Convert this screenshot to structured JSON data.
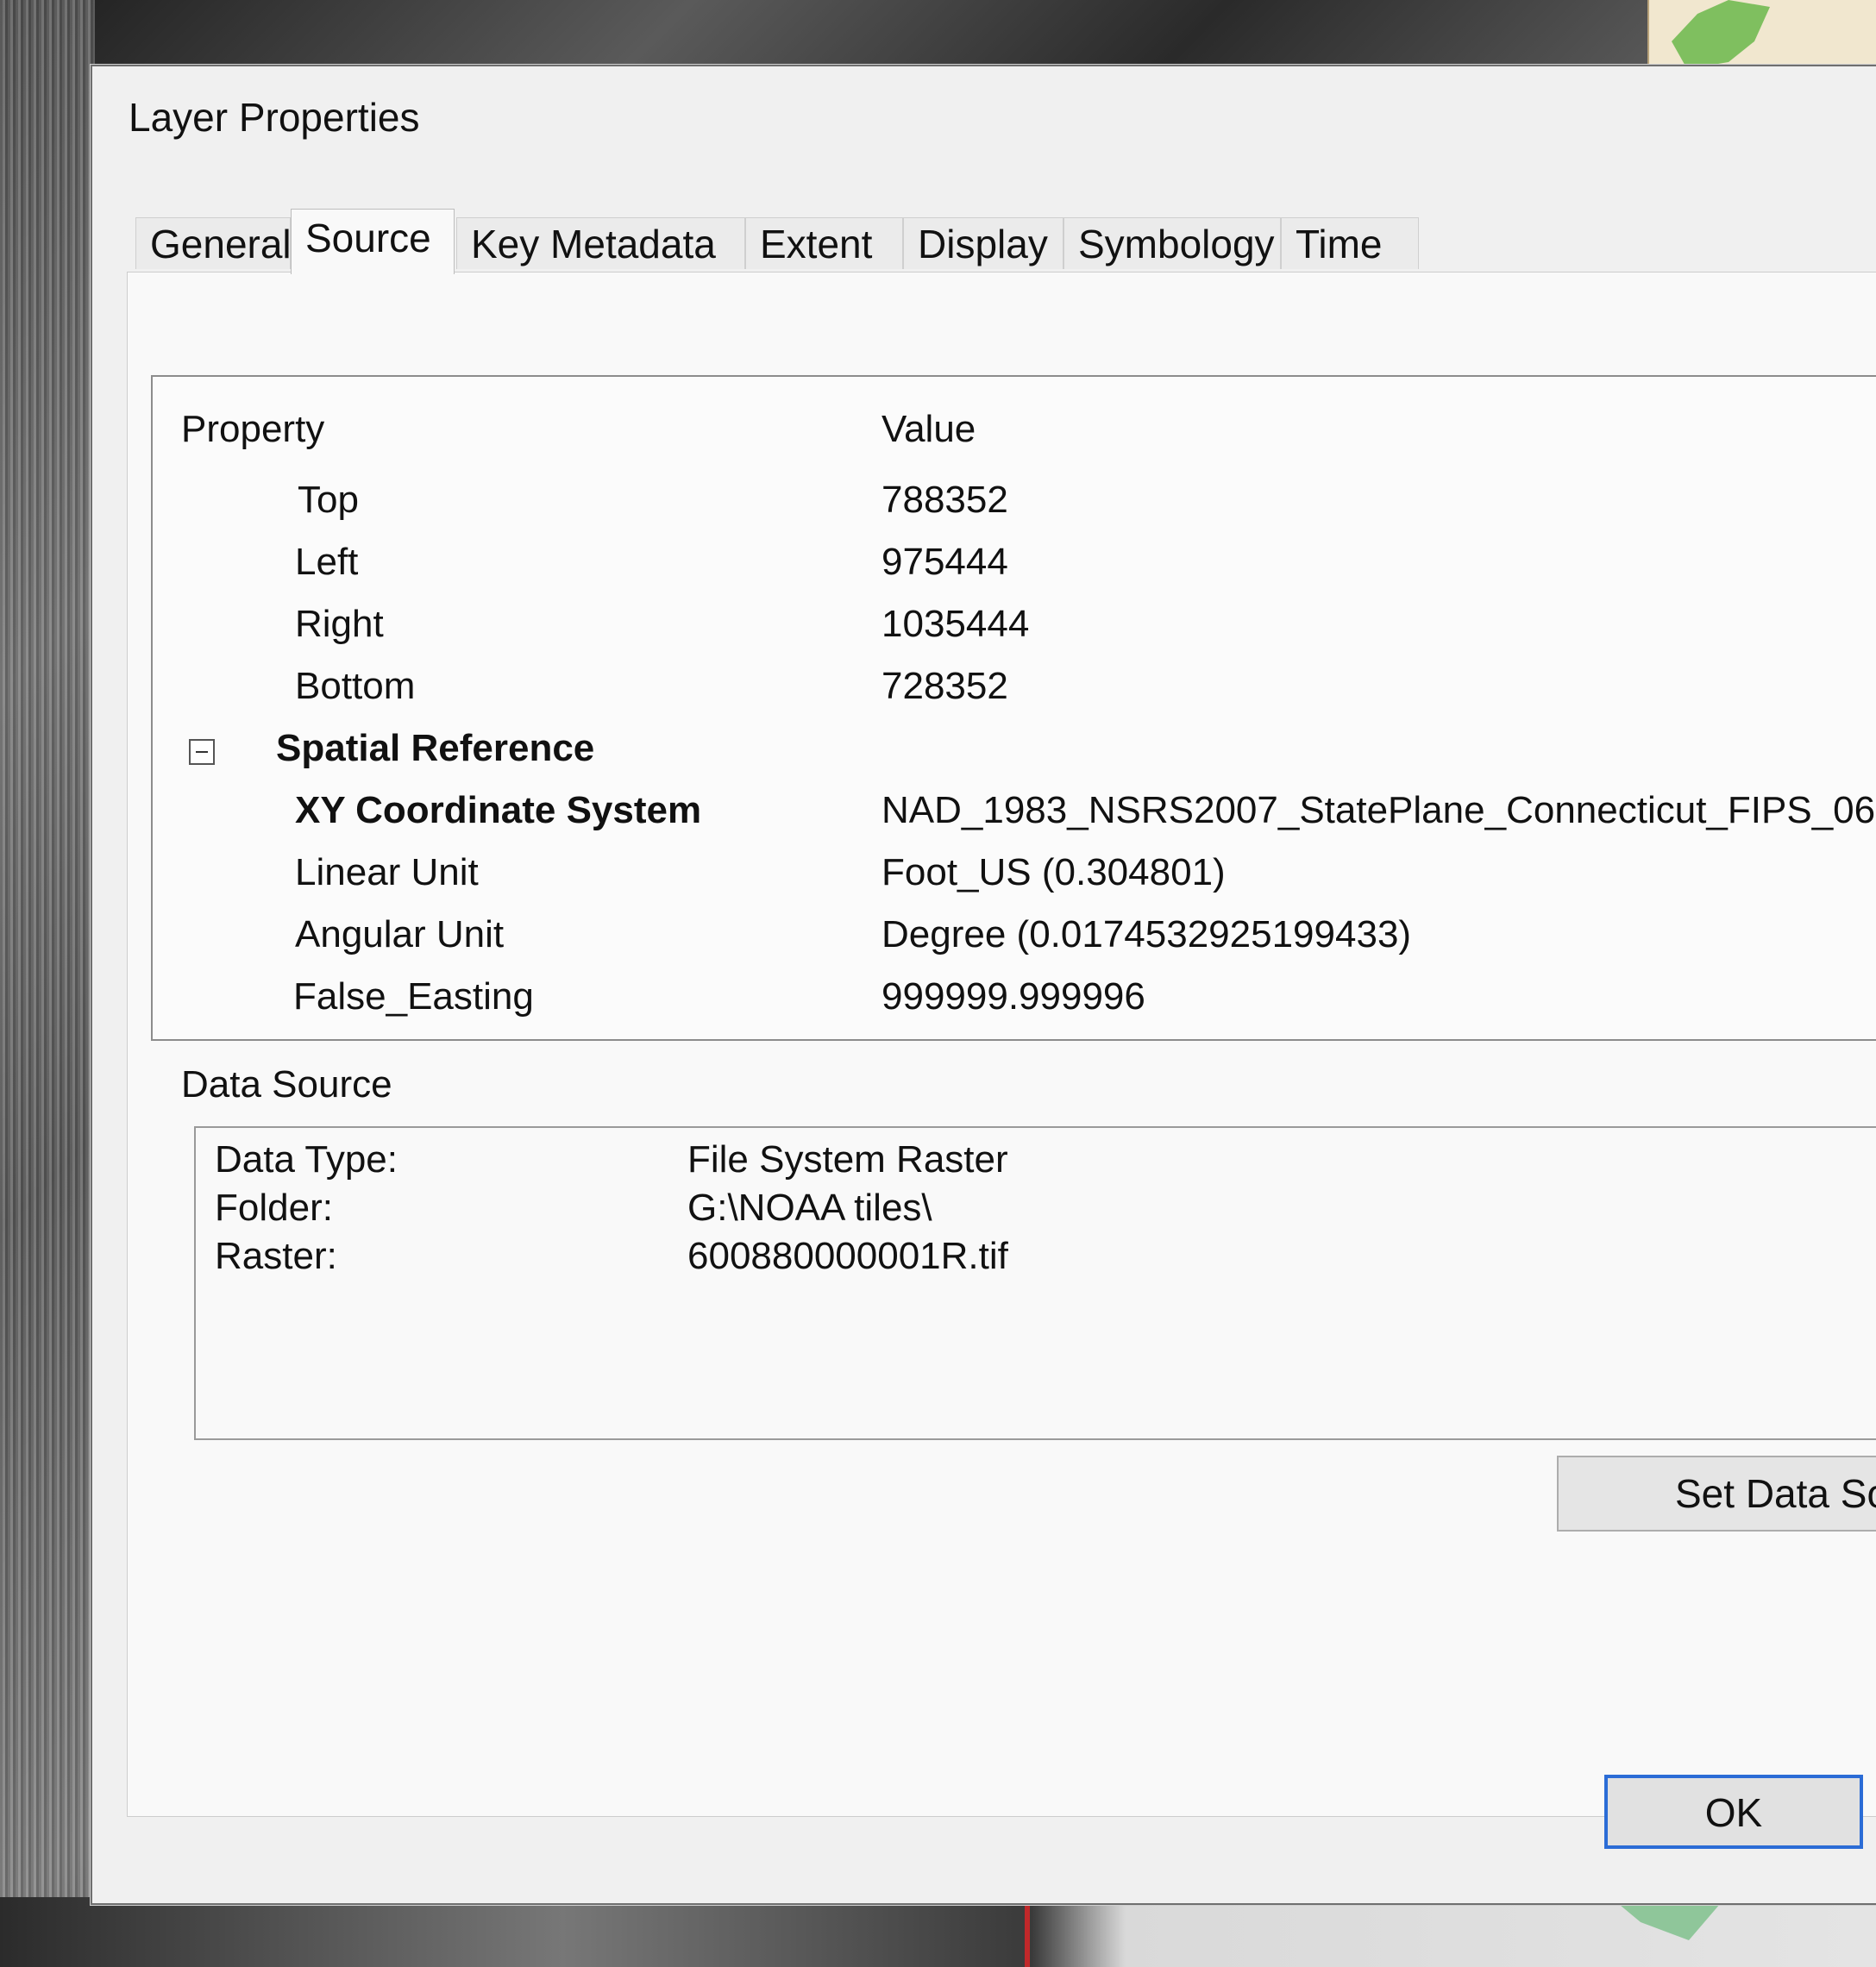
{
  "dialog": {
    "title": "Layer Properties"
  },
  "tabs": [
    {
      "label": "General"
    },
    {
      "label": "Source"
    },
    {
      "label": "Key Metadata"
    },
    {
      "label": "Extent"
    },
    {
      "label": "Display"
    },
    {
      "label": "Symbology"
    },
    {
      "label": "Time"
    }
  ],
  "active_tab": "Source",
  "property_grid": {
    "header_property": "Property",
    "header_value": "Value",
    "rows": [
      {
        "property": "Top",
        "value": "788352"
      },
      {
        "property": "Left",
        "value": "975444"
      },
      {
        "property": "Right",
        "value": "1035444"
      },
      {
        "property": "Bottom",
        "value": "728352"
      },
      {
        "property": "Spatial Reference",
        "value": ""
      },
      {
        "property": "XY Coordinate System",
        "value": "NAD_1983_NSRS2007_StatePlane_Connecticut_FIPS_06"
      },
      {
        "property": "Linear Unit",
        "value": "Foot_US (0.304801)"
      },
      {
        "property": "Angular Unit",
        "value": "Degree (0.0174532925199433)"
      },
      {
        "property": "False_Easting",
        "value": "999999.999996"
      }
    ]
  },
  "data_source": {
    "label": "Data Source",
    "items": [
      {
        "key": "Data Type:",
        "value": "File System Raster"
      },
      {
        "key": "Folder:",
        "value": "G:\\NOAA tiles\\"
      },
      {
        "key": "Raster:",
        "value": "600880000001R.tif"
      }
    ]
  },
  "buttons": {
    "set_data_source": "Set Data So",
    "ok": "OK"
  },
  "icons": {
    "collapse": "minus-box-icon"
  }
}
